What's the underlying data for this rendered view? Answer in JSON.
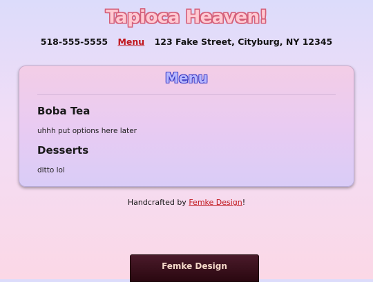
{
  "header": {
    "site_title": "Tapioca Heaven!",
    "phone": "518-555-5555",
    "menu_link": "Menu",
    "address": "123 Fake Street, Cityburg, NY 12345"
  },
  "panel": {
    "title": "Menu",
    "sections": [
      {
        "heading": "Boba Tea",
        "text": "uhhh put options here later"
      },
      {
        "heading": "Desserts",
        "text": "ditto lol"
      }
    ]
  },
  "footer": {
    "prefix": "Handcrafted by ",
    "link": "Femke Design",
    "suffix": "!"
  },
  "badge": {
    "label": "Femke Design"
  }
}
